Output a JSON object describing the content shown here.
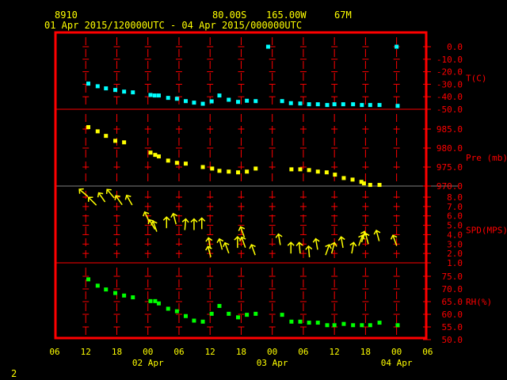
{
  "header": {
    "station": "8910",
    "lat": "80.00S",
    "lon": "165.00W",
    "elev": "67M",
    "period": "01 Apr 2015/120000UTC - 04 Apr 2015/000000UTC"
  },
  "page_number": "2",
  "colors": {
    "frame": "#ff0000",
    "temp": "#00ffff",
    "pres": "#ffff00",
    "wind": "#ffff00",
    "rh": "#00ff00",
    "text": "#ffff00"
  },
  "chart_data": [
    {
      "type": "scatter",
      "name": "temperature",
      "ylabel": "T(C)",
      "ylim": [
        -50,
        0
      ],
      "yticks": [
        "0.0",
        "-10.0",
        "-20.0",
        "-30.0",
        "-40.0",
        "-50.0"
      ],
      "ytick_values": [
        0,
        -10,
        -20,
        -30,
        -40,
        -50
      ],
      "x_unit": "hours since 01 Apr 06UTC",
      "points": [
        [
          6.5,
          -29.5
        ],
        [
          8.3,
          -31.6
        ],
        [
          9.9,
          -33.3
        ],
        [
          11.7,
          -34.6
        ],
        [
          13.4,
          -35.9
        ],
        [
          15.1,
          -36.5
        ],
        [
          18.5,
          -38.6
        ],
        [
          19.3,
          -39
        ],
        [
          20.1,
          -39
        ],
        [
          21.9,
          -40.9
        ],
        [
          23.6,
          -41.6
        ],
        [
          25.3,
          -43.5
        ],
        [
          26.9,
          -44.7
        ],
        [
          28.6,
          -45.6
        ],
        [
          30.3,
          -43.7
        ],
        [
          31.8,
          -39
        ],
        [
          33.6,
          -42.4
        ],
        [
          35.4,
          -44.1
        ],
        [
          37.1,
          -43.2
        ],
        [
          38.8,
          -43.5
        ],
        [
          41.2,
          0
        ],
        [
          43.9,
          -43.5
        ],
        [
          45.6,
          -45.1
        ],
        [
          47.4,
          -45.4
        ],
        [
          49.1,
          -46
        ],
        [
          50.8,
          -46
        ],
        [
          52.6,
          -46.6
        ],
        [
          54,
          -46
        ],
        [
          55.7,
          -46
        ],
        [
          57.6,
          -46
        ],
        [
          59.3,
          -46.6
        ],
        [
          60.9,
          -46.6
        ],
        [
          62.7,
          -46.6
        ],
        [
          66,
          0
        ],
        [
          66.2,
          -47.3
        ]
      ]
    },
    {
      "type": "scatter",
      "name": "pressure",
      "ylabel": "Pre (mb)",
      "ylim": [
        970,
        985
      ],
      "yticks": [
        "985.0",
        "980.0",
        "975.0",
        "970.0"
      ],
      "ytick_values": [
        985,
        980,
        975,
        970
      ],
      "points": [
        [
          6.5,
          985.5
        ],
        [
          8.3,
          984.4
        ],
        [
          9.9,
          983.2
        ],
        [
          11.7,
          981.9
        ],
        [
          13.4,
          981.5
        ],
        [
          18.5,
          978.8
        ],
        [
          19.4,
          978.2
        ],
        [
          20.1,
          977.8
        ],
        [
          21.9,
          976.7
        ],
        [
          23.6,
          976.1
        ],
        [
          25.3,
          975.9
        ],
        [
          28.6,
          975
        ],
        [
          30.4,
          974.6
        ],
        [
          31.8,
          974
        ],
        [
          33.6,
          973.8
        ],
        [
          35.4,
          973.6
        ],
        [
          37.1,
          973.8
        ],
        [
          38.8,
          974.6
        ],
        [
          45.7,
          974.4
        ],
        [
          47.4,
          974.4
        ],
        [
          49.1,
          974.2
        ],
        [
          50.8,
          973.8
        ],
        [
          52.5,
          973.6
        ],
        [
          54.1,
          973
        ],
        [
          55.8,
          972.1
        ],
        [
          57.5,
          971.7
        ],
        [
          59.2,
          971.1
        ],
        [
          59.7,
          970.7
        ],
        [
          60.9,
          970.3
        ],
        [
          62.7,
          970.3
        ]
      ]
    },
    {
      "type": "vector",
      "name": "wind",
      "ylabel": "SPD(MPS)",
      "ylim": [
        1,
        8
      ],
      "yticks": [
        "8.0",
        "7.0",
        "6.0",
        "5.0",
        "4.0",
        "3.0",
        "2.0",
        "1.0"
      ],
      "ytick_values": [
        8,
        7,
        6,
        5,
        4,
        3,
        2,
        1
      ],
      "points_hours_speed_dirdeg": [
        [
          5.7,
          8.4,
          -50
        ],
        [
          7.4,
          7.5,
          -45
        ],
        [
          9.2,
          7.9,
          -35
        ],
        [
          10.9,
          8.3,
          -40
        ],
        [
          12.5,
          7.6,
          -35
        ],
        [
          14.5,
          7.6,
          -30
        ],
        [
          17.9,
          5.8,
          -25
        ],
        [
          18.9,
          5.0,
          -30
        ],
        [
          19.4,
          4.8,
          -20
        ],
        [
          21.6,
          5.2,
          0
        ],
        [
          23.2,
          5.6,
          -15
        ],
        [
          25.2,
          5.0,
          5
        ],
        [
          26.9,
          5.0,
          0
        ],
        [
          28.4,
          5.1,
          0
        ],
        [
          29.9,
          3.0,
          -10
        ],
        [
          29.9,
          2.1,
          -15
        ],
        [
          32.1,
          2.9,
          -15
        ],
        [
          33.3,
          2.5,
          -20
        ],
        [
          35.3,
          3.1,
          0
        ],
        [
          36.3,
          4.2,
          -20
        ],
        [
          36.5,
          3.1,
          -20
        ],
        [
          38.4,
          2.3,
          -20
        ],
        [
          43.4,
          3.4,
          -10
        ],
        [
          45.6,
          2.5,
          0
        ],
        [
          47.3,
          2.5,
          -5
        ],
        [
          49.1,
          2.1,
          -5
        ],
        [
          50.6,
          2.9,
          -10
        ],
        [
          52.6,
          2.3,
          20
        ],
        [
          53.7,
          2.5,
          15
        ],
        [
          55.5,
          3.1,
          -10
        ],
        [
          57.5,
          2.5,
          10
        ],
        [
          59.0,
          3.3,
          20
        ],
        [
          59.5,
          3.7,
          15
        ],
        [
          60.3,
          3.5,
          -15
        ],
        [
          62.4,
          3.8,
          -15
        ],
        [
          65.7,
          3.3,
          -20
        ]
      ]
    },
    {
      "type": "scatter",
      "name": "relative_humidity",
      "ylabel": "RH(%)",
      "ylim": [
        50,
        75
      ],
      "yticks": [
        "75.0",
        "70.0",
        "65.0",
        "60.0",
        "55.0",
        "50.0"
      ],
      "ytick_values": [
        75,
        70,
        65,
        60,
        55,
        50
      ],
      "points": [
        [
          6.5,
          73.8
        ],
        [
          8.3,
          71.3
        ],
        [
          9.9,
          69.8
        ],
        [
          11.7,
          68.4
        ],
        [
          13.4,
          67.4
        ],
        [
          15.1,
          66.7
        ],
        [
          18.5,
          65.2
        ],
        [
          19.4,
          65.2
        ],
        [
          20.1,
          64.3
        ],
        [
          21.9,
          62.2
        ],
        [
          23.6,
          61.2
        ],
        [
          25.3,
          59.3
        ],
        [
          26.9,
          57.5
        ],
        [
          28.6,
          57.1
        ],
        [
          30.3,
          60.2
        ],
        [
          31.8,
          63.3
        ],
        [
          33.6,
          60.2
        ],
        [
          35.4,
          58.8
        ],
        [
          37.1,
          59.8
        ],
        [
          38.8,
          60.2
        ],
        [
          43.9,
          59.8
        ],
        [
          45.7,
          57.1
        ],
        [
          47.4,
          57.1
        ],
        [
          49.1,
          56.7
        ],
        [
          50.8,
          56.7
        ],
        [
          52.6,
          55.7
        ],
        [
          54,
          55.7
        ],
        [
          55.8,
          56.2
        ],
        [
          57.6,
          55.7
        ],
        [
          59.3,
          55.7
        ],
        [
          60.9,
          55.7
        ],
        [
          62.7,
          56.7
        ],
        [
          66.2,
          55.7
        ]
      ]
    }
  ],
  "x_axis": {
    "hour_labels": [
      "06",
      "12",
      "18",
      "00",
      "06",
      "12",
      "18",
      "00",
      "06",
      "12",
      "18",
      "00",
      "06"
    ],
    "date_labels": [
      {
        "label": "02 Apr",
        "hour": 18
      },
      {
        "label": "03 Apr",
        "hour": 42
      },
      {
        "label": "04 Apr",
        "hour": 66
      }
    ]
  }
}
